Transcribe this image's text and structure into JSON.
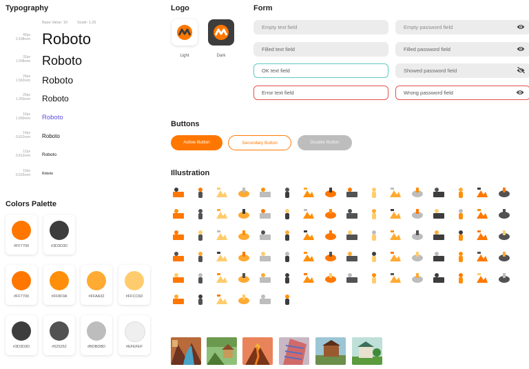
{
  "typography": {
    "title": "Typography",
    "base_value": "Base Value: 16",
    "scale": "Scale: 1.25",
    "rows": [
      {
        "px": "40px",
        "rem": "2.438rem",
        "sample": "Roboto"
      },
      {
        "px": "32px",
        "rem": "1.938rem",
        "sample": "Roboto"
      },
      {
        "px": "24px",
        "rem": "1.562rem",
        "sample": "Roboto"
      },
      {
        "px": "20px",
        "rem": "1.250rem",
        "sample": "Roboto"
      },
      {
        "px": "16px",
        "rem": "1.000rem",
        "sample": "Roboto"
      },
      {
        "px": "14px",
        "rem": "0.812rem",
        "sample": "Roboto"
      },
      {
        "px": "12px",
        "rem": "0.812rem",
        "sample": "Roboto"
      },
      {
        "px": "10px",
        "rem": "0.625rem",
        "sample": "Roboto"
      }
    ],
    "highlight_color": "#5b4fd6"
  },
  "colors": {
    "title": "Colors Palette",
    "swatches": [
      {
        "label": "#FF7700",
        "color": "#FF7700"
      },
      {
        "label": "#3D3D3D",
        "color": "#3D3D3D"
      },
      {
        "label": "#FF7700",
        "color": "#FF7700"
      },
      {
        "label": "#FF8F0A",
        "color": "#FF8F0A"
      },
      {
        "label": "#FFAA32",
        "color": "#FFAA32"
      },
      {
        "label": "#FFCC6D",
        "color": "#FFCC6D"
      },
      {
        "label": "#3D3D3D",
        "color": "#3D3D3D"
      },
      {
        "label": "#525252",
        "color": "#525252"
      },
      {
        "label": "#BDBDBD",
        "color": "#BDBDBD"
      },
      {
        "label": "#EFEFEF",
        "color": "#EFEFEF"
      }
    ]
  },
  "logo": {
    "title": "Logo",
    "light_label": "Light",
    "dark_label": "Dark"
  },
  "form": {
    "title": "Form",
    "fields": [
      {
        "text": "Empty text field",
        "state": "empty",
        "eye": "none"
      },
      {
        "text": "Empty password field",
        "state": "empty",
        "eye": "eye-icon"
      },
      {
        "text": "Filled text field",
        "state": "filled",
        "eye": "none"
      },
      {
        "text": "Filled password field",
        "state": "filled",
        "eye": "eye-icon"
      },
      {
        "text": "OK text field",
        "state": "ok",
        "eye": "none"
      },
      {
        "text": "Showed password field",
        "state": "filled",
        "eye": "eye-off-icon"
      },
      {
        "text": "Error text field",
        "state": "err",
        "eye": "none"
      },
      {
        "text": "Wrong password field",
        "state": "err",
        "eye": "eye-icon"
      }
    ]
  },
  "buttons": {
    "title": "Buttons",
    "active": "Active Button",
    "secondary": "Secondary Button",
    "disabled": "Disable Button"
  },
  "illustration": {
    "title": "Illustration"
  }
}
